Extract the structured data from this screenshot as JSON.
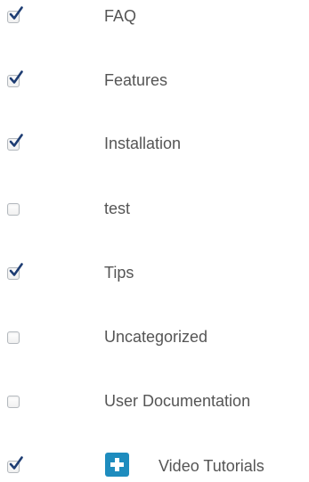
{
  "categories": [
    {
      "label": "FAQ",
      "checked": true
    },
    {
      "label": "Features",
      "checked": true
    },
    {
      "label": "Installation",
      "checked": true
    },
    {
      "label": "test",
      "checked": false
    },
    {
      "label": "Tips",
      "checked": true
    },
    {
      "label": "Uncategorized",
      "checked": false
    },
    {
      "label": "User Documentation",
      "checked": false
    },
    {
      "label": "Video Tutorials",
      "checked": true,
      "icon": "plus-icon"
    }
  ],
  "colors": {
    "text": "#555555",
    "checkmark": "#1e3d73",
    "checkbox_border": "#b4b9be",
    "plus_button": "#1e8cbe"
  }
}
